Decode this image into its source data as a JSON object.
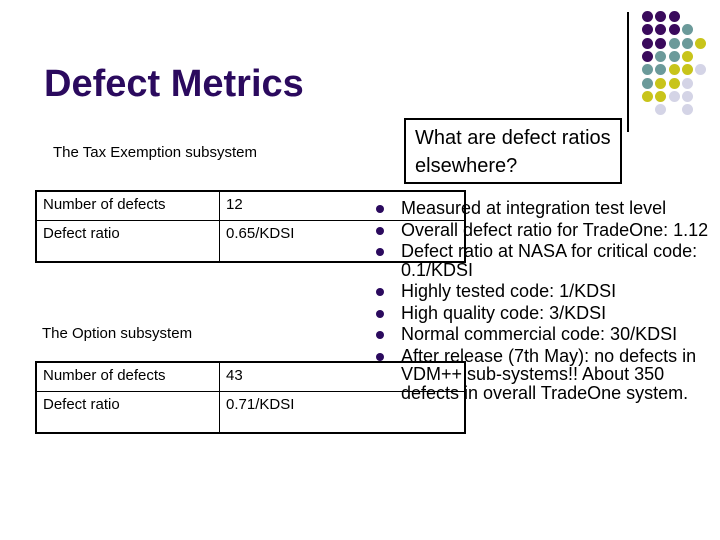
{
  "slide": {
    "title": "Defect Metrics",
    "callout": "What are defect ratios elsewhere?",
    "colors": {
      "title": "#2b0a5e",
      "bullet": "#2b0a5e",
      "dot_purple": "#3a0a5c",
      "dot_teal": "#6b9a9a",
      "dot_yellow": "#c8c41a",
      "dot_lavender": "#d4d4e6"
    },
    "decoration": {
      "dot_rows": [
        [
          "purple",
          "purple",
          "purple",
          null,
          null
        ],
        [
          "purple",
          "purple",
          "purple",
          "teal",
          null
        ],
        [
          "purple",
          "purple",
          "teal",
          "teal",
          "yellow"
        ],
        [
          "purple",
          "teal",
          "teal",
          "yellow",
          null
        ],
        [
          "teal",
          "teal",
          "yellow",
          "yellow",
          "lavender"
        ],
        [
          "teal",
          "yellow",
          "yellow",
          "lavender",
          null
        ],
        [
          "yellow",
          "yellow",
          "lavender",
          "lavender",
          null
        ],
        [
          null,
          "lavender",
          null,
          "lavender",
          null
        ]
      ]
    }
  },
  "tax_exemption": {
    "heading": "The Tax Exemption subsystem",
    "rows": [
      {
        "label": "Number of defects",
        "value": "12"
      },
      {
        "label": "Defect ratio",
        "value": "0.65/KDSI"
      }
    ]
  },
  "option": {
    "heading": "The Option subsystem",
    "rows": [
      {
        "label": "Number of defects",
        "value": "43"
      },
      {
        "label": "Defect ratio",
        "value": "0.71/KDSI"
      }
    ]
  },
  "bullets": [
    "Measured at integration test level",
    "Overall defect ratio for TradeOne: 1.12",
    "Defect ratio at NASA for critical code: 0.1/KDSI",
    "Highly tested code: 1/KDSI",
    "High quality code: 3/KDSI",
    "Normal commercial code: 30/KDSI",
    "After release (7th May): no defects in VDM++ sub-systems!! About 350 defects in overall TradeOne system."
  ]
}
